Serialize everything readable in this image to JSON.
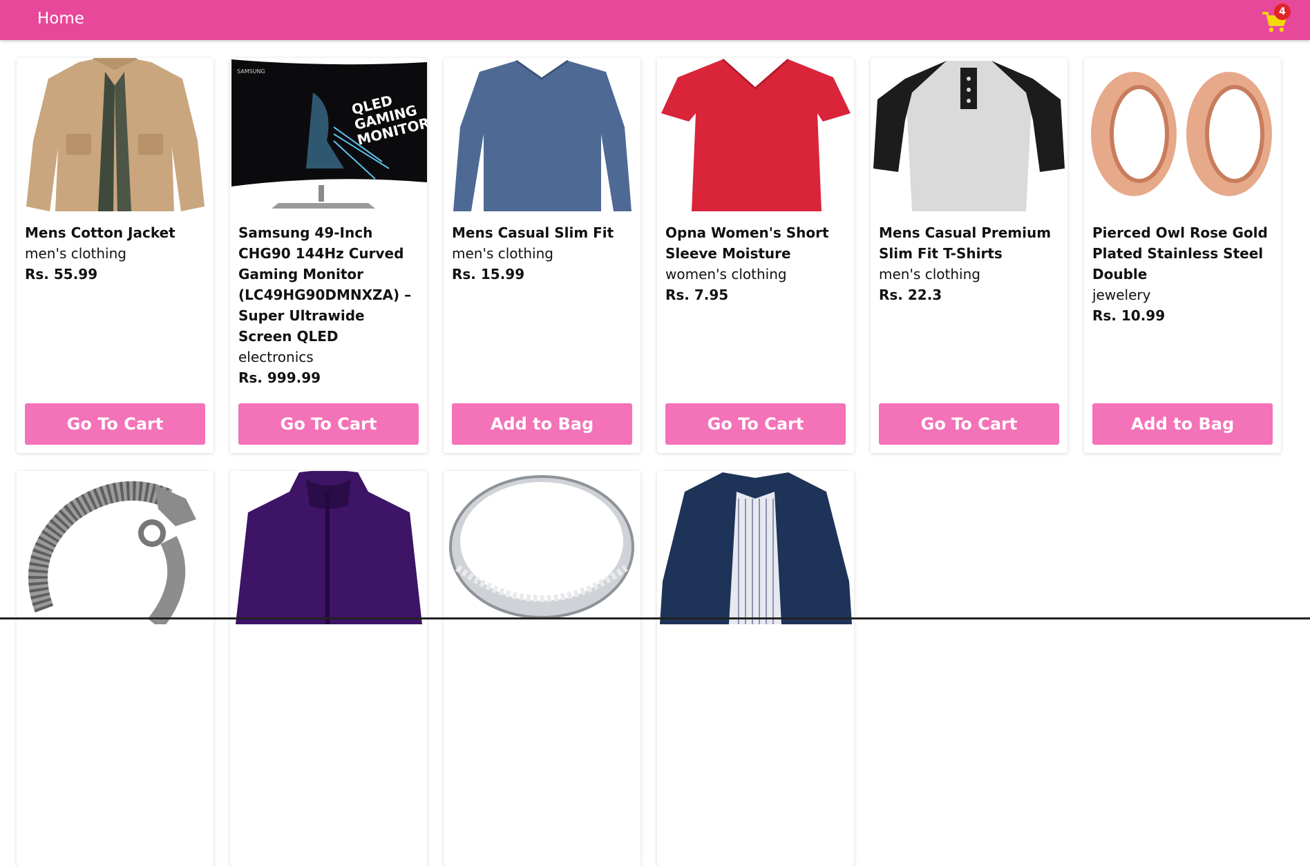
{
  "navbar": {
    "home_label": "Home",
    "cart_count": "4",
    "cart_icon": "shopping-cart-icon"
  },
  "colors": {
    "navbar": "#e8489a",
    "button": "#f472b8",
    "badge": "#e0262b",
    "cart_icon": "#f5d90a"
  },
  "products": [
    {
      "name": "Mens Cotton Jacket",
      "category": "men's clothing",
      "price": "Rs. 55.99",
      "button": "Go To Cart",
      "image": "beige-jacket"
    },
    {
      "name": "Samsung 49-Inch CHG90 144Hz Curved Gaming Monitor (LC49HG90DMNXZA) – Super Ultrawide Screen QLED",
      "category": "electronics",
      "price": "Rs. 999.99",
      "button": "Go To Cart",
      "image": "curved-monitor",
      "image_text": [
        "QLED",
        "GAMING",
        "MONITOR"
      ],
      "image_brand": "SAMSUNG"
    },
    {
      "name": "Mens Casual Slim Fit",
      "category": "men's clothing",
      "price": "Rs. 15.99",
      "button": "Add to Bag",
      "image": "blue-longsleeve"
    },
    {
      "name": "Opna Women's Short Sleeve Moisture",
      "category": "women's clothing",
      "price": "Rs. 7.95",
      "button": "Go To Cart",
      "image": "red-tshirt"
    },
    {
      "name": "Mens Casual Premium Slim Fit T-Shirts",
      "category": "men's clothing",
      "price": "Rs. 22.3",
      "button": "Go To Cart",
      "image": "raglan-shirt"
    },
    {
      "name": "Pierced Owl Rose Gold Plated Stainless Steel Double",
      "category": "jewelery",
      "price": "Rs. 10.99",
      "button": "Add to Bag",
      "image": "rose-gold-plugs"
    },
    {
      "image": "dragon-bracelet"
    },
    {
      "image": "purple-jacket"
    },
    {
      "image": "silver-ring"
    },
    {
      "image": "navy-jacket"
    }
  ]
}
